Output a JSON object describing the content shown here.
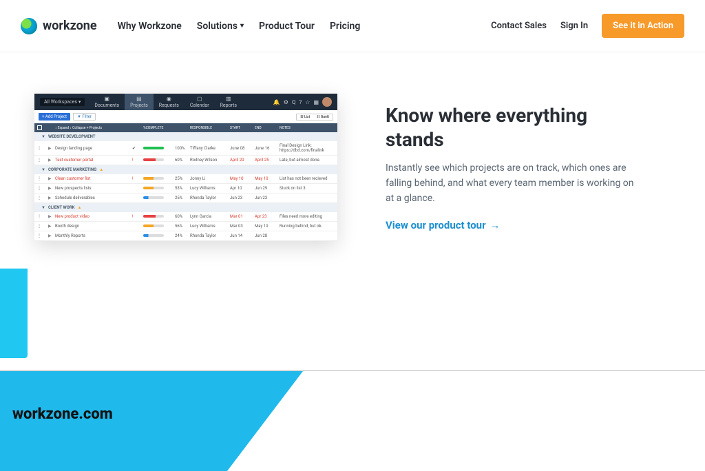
{
  "brand": "workzone",
  "nav": {
    "why": "Why Workzone",
    "solutions": "Solutions",
    "tour": "Product Tour",
    "pricing": "Pricing"
  },
  "right": {
    "contact": "Contact Sales",
    "signin": "Sign In",
    "cta": "See it in Action"
  },
  "hero": {
    "title": "Know where everything stands",
    "body": "Instantly see which projects are on track, which ones are falling behind, and what every team member is working on at a glance.",
    "link": "View our product tour"
  },
  "app": {
    "ws": "All Workspaces",
    "tabs": {
      "doc": "Documents",
      "proj": "Projects",
      "req": "Requests",
      "cal": "Calendar",
      "rep": "Reports"
    },
    "add": "+ Add Project",
    "filter": "▼ Filter",
    "list": "☰ List",
    "gantt": "☷ Gantt",
    "ctrl": {
      "expand": "↕ Expand",
      "collapse": "↕ Collapse",
      "plus": "+ Projects"
    },
    "cols": {
      "pct": "%COMPLETE",
      "resp": "RESPONSIBLE",
      "start": "START",
      "end": "END",
      "notes": "NOTES"
    },
    "s1": "WEBSITE DEVELOPMENT",
    "s2": "CORPORATE MARKETING",
    "s3": "CLIENT WORK",
    "rows": [
      {
        "n": "Design landing page",
        "st": "✔",
        "bar": "g",
        "pct": "100%",
        "r": "Tiffany Clarke",
        "s": "June 08",
        "e": "June 16",
        "x": "Final Design Link: https://dbd.com/finalink"
      },
      {
        "n": "Test customer portal",
        "cls": "red",
        "st": "!",
        "bar": "r",
        "pct": "60%",
        "r": "Rodney Wilson",
        "s": "April 20",
        "e": "April 25",
        "scls": "red",
        "ecls": "red",
        "x": "Late, but almost done."
      },
      {
        "n": "Clean customer list",
        "cls": "red",
        "st": "!",
        "bar": "o",
        "pct": "25%",
        "r": "Jonny Li",
        "s": "May 10",
        "e": "May 10",
        "scls": "red",
        "ecls": "red",
        "x": "List has not been recieved"
      },
      {
        "n": "New prospects lists",
        "bar": "o",
        "pct": "53%",
        "r": "Lucy Williams",
        "s": "Apr 10",
        "e": "Jun 29",
        "x": "Stuck on list 3"
      },
      {
        "n": "Schedule deliverables",
        "bar": "b",
        "pct": "25%",
        "r": "Rhonda Taylor",
        "s": "Jun 23",
        "e": "Jun 23",
        "x": ""
      },
      {
        "n": "New product video",
        "cls": "red",
        "st": "!",
        "bar": "r",
        "pct": "60%",
        "r": "Lynn Garcia",
        "s": "Mar 01",
        "e": "Apr 23",
        "scls": "red",
        "ecls": "red",
        "x": "Files need more editing"
      },
      {
        "n": "Booth design",
        "bar": "o",
        "pct": "56%",
        "r": "Lucy Williams",
        "s": "Mar 03",
        "e": "May 10",
        "x": "Running behind, but ok."
      },
      {
        "n": "Monthly Reports",
        "bar": "b",
        "pct": "24%",
        "r": "Rhonda Taylor",
        "s": "Jun 14",
        "e": "Jun 28",
        "x": ""
      }
    ]
  },
  "footer": "workzone.com"
}
